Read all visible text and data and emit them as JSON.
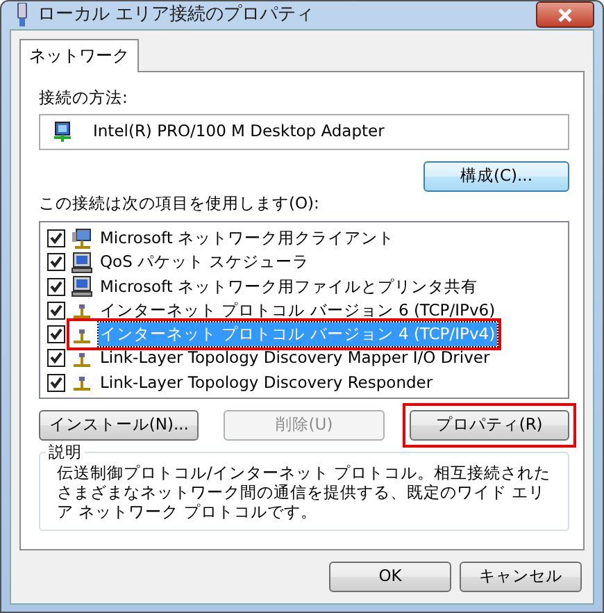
{
  "window": {
    "title": "ローカル エリア接続のプロパティ"
  },
  "tabs": [
    {
      "label": "ネットワーク",
      "selected": true
    }
  ],
  "connect_using": {
    "label": "接続の方法:",
    "adapter": "Intel(R) PRO/100 M Desktop Adapter"
  },
  "configure_button": {
    "label": "構成(C)..."
  },
  "items_label": "この接続は次の項目を使用します(O):",
  "items": [
    {
      "label": "Microsoft ネットワーク用クライアント",
      "kind": "client",
      "checked": true,
      "selected": false,
      "highlighted": false
    },
    {
      "label": "QoS パケット スケジューラ",
      "kind": "service",
      "checked": true,
      "selected": false,
      "highlighted": false
    },
    {
      "label": "Microsoft ネットワーク用ファイルとプリンタ共有",
      "kind": "service",
      "checked": true,
      "selected": false,
      "highlighted": false
    },
    {
      "label": "インターネット プロトコル バージョン 6 (TCP/IPv6)",
      "kind": "protocol",
      "checked": true,
      "selected": false,
      "highlighted": false
    },
    {
      "label": "インターネット プロトコル バージョン 4 (TCP/IPv4)",
      "kind": "protocol",
      "checked": true,
      "selected": true,
      "highlighted": true
    },
    {
      "label": "Link-Layer Topology Discovery Mapper I/O Driver",
      "kind": "protocol",
      "checked": true,
      "selected": false,
      "highlighted": false
    },
    {
      "label": "Link-Layer Topology Discovery Responder",
      "kind": "protocol",
      "checked": true,
      "selected": false,
      "highlighted": false
    }
  ],
  "action_buttons": [
    {
      "label": "インストール(N)...",
      "disabled": false,
      "highlighted": false
    },
    {
      "label": "削除(U)",
      "disabled": true,
      "highlighted": false
    },
    {
      "label": "プロパティ(R)",
      "disabled": false,
      "highlighted": true
    }
  ],
  "description": {
    "label": "説明",
    "text": "伝送制御プロトコル/インターネット プロトコル。相互接続されたさまざまなネットワーク間の通信を提供する、既定のワイド エリア ネットワーク プロトコルです。"
  },
  "buttons": [
    {
      "label": "OK"
    },
    {
      "label": "キャンセル"
    }
  ]
}
